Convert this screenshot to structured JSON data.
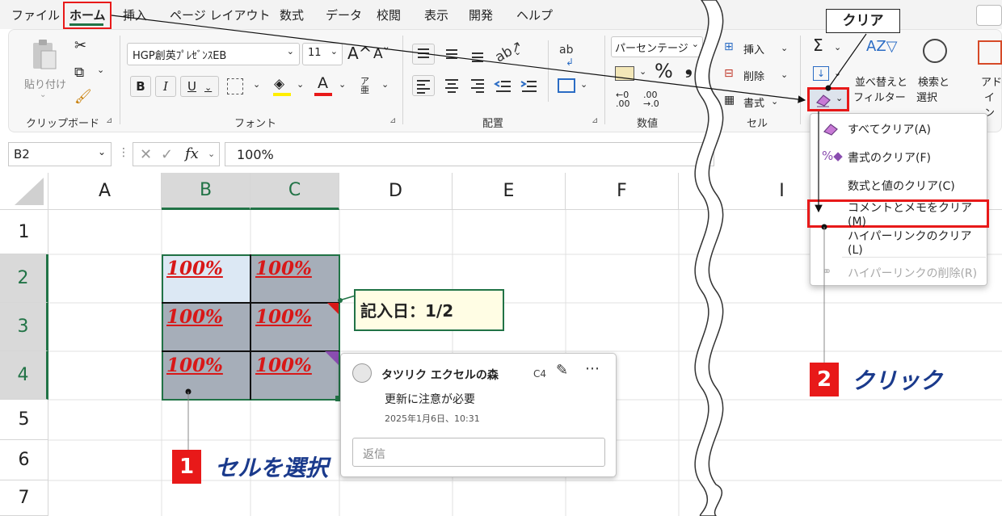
{
  "menu": [
    "ファイル",
    "ホーム",
    "挿入",
    "ページ レイアウト",
    "数式",
    "データ",
    "校閲",
    "表示",
    "開発",
    "ヘルプ"
  ],
  "ribbon": {
    "clipboard": {
      "paste_label": "貼り付け",
      "group_label": "クリップボード"
    },
    "font": {
      "font_name": "HGP創英ﾌﾟﾚｾﾞﾝｽEB",
      "font_size": "11",
      "bold": "B",
      "italic": "I",
      "underline": "U",
      "font_color_glyph": "A",
      "phonetic_glyph": "ア亜",
      "grow_glyph": "A^",
      "shrink_glyph": "Aˇ",
      "group_label": "フォント"
    },
    "alignment": {
      "wrap_glyph": "ab",
      "group_label": "配置"
    },
    "number": {
      "format": "パーセンテージ",
      "percent": "%",
      "comma": "9",
      "group_label": "数値"
    },
    "cells": {
      "insert": "挿入",
      "delete": "削除",
      "format": "書式",
      "group_label": "セル"
    },
    "editing": {
      "sort_filter": "並べ替えと\nフィルター",
      "sort_line1": "並べ替えと",
      "sort_line2": "フィルター",
      "find_line1": "検索と",
      "find_line2": "選択",
      "addin_line1": "アド",
      "addin_line2": "イン"
    }
  },
  "formula_bar": {
    "name_box": "B2",
    "fx": "fx",
    "value": "100%"
  },
  "columns": [
    "A",
    "B",
    "C",
    "D",
    "E",
    "F",
    "I"
  ],
  "rows": [
    "1",
    "2",
    "3",
    "4",
    "5",
    "6",
    "7"
  ],
  "cells": {
    "b2": "100%",
    "c2": "100%",
    "b3": "100%",
    "c3": "100%",
    "b4": "100%",
    "c4": "100%"
  },
  "note_text": "記入日：1/2",
  "comment": {
    "author": "タツリク エクセルの森",
    "cell_ref": "C4",
    "body": "更新に注意が必要",
    "timestamp": "2025年1月6日、10:31",
    "reply_placeholder": "返信"
  },
  "clear_callout": "クリア",
  "dropdown": [
    {
      "label": "すべてクリア(A)",
      "enabled": true
    },
    {
      "label": "書式のクリア(F)",
      "enabled": true
    },
    {
      "label": "数式と値のクリア(C)",
      "enabled": true
    },
    {
      "label": "コメントとメモをクリア(M)",
      "enabled": true
    },
    {
      "label": "ハイパーリンクのクリア(L)",
      "enabled": true
    },
    {
      "label": "ハイパーリンクの削除(R)",
      "enabled": false
    }
  ],
  "steps": [
    {
      "number": "1",
      "label": "セルを選択"
    },
    {
      "number": "2",
      "label": "クリック"
    }
  ],
  "colors": {
    "accent_red": "#e81919",
    "step_text": "#1a3a8c",
    "excel_green": "#217346",
    "selected_cell": "#a6aeb9"
  }
}
